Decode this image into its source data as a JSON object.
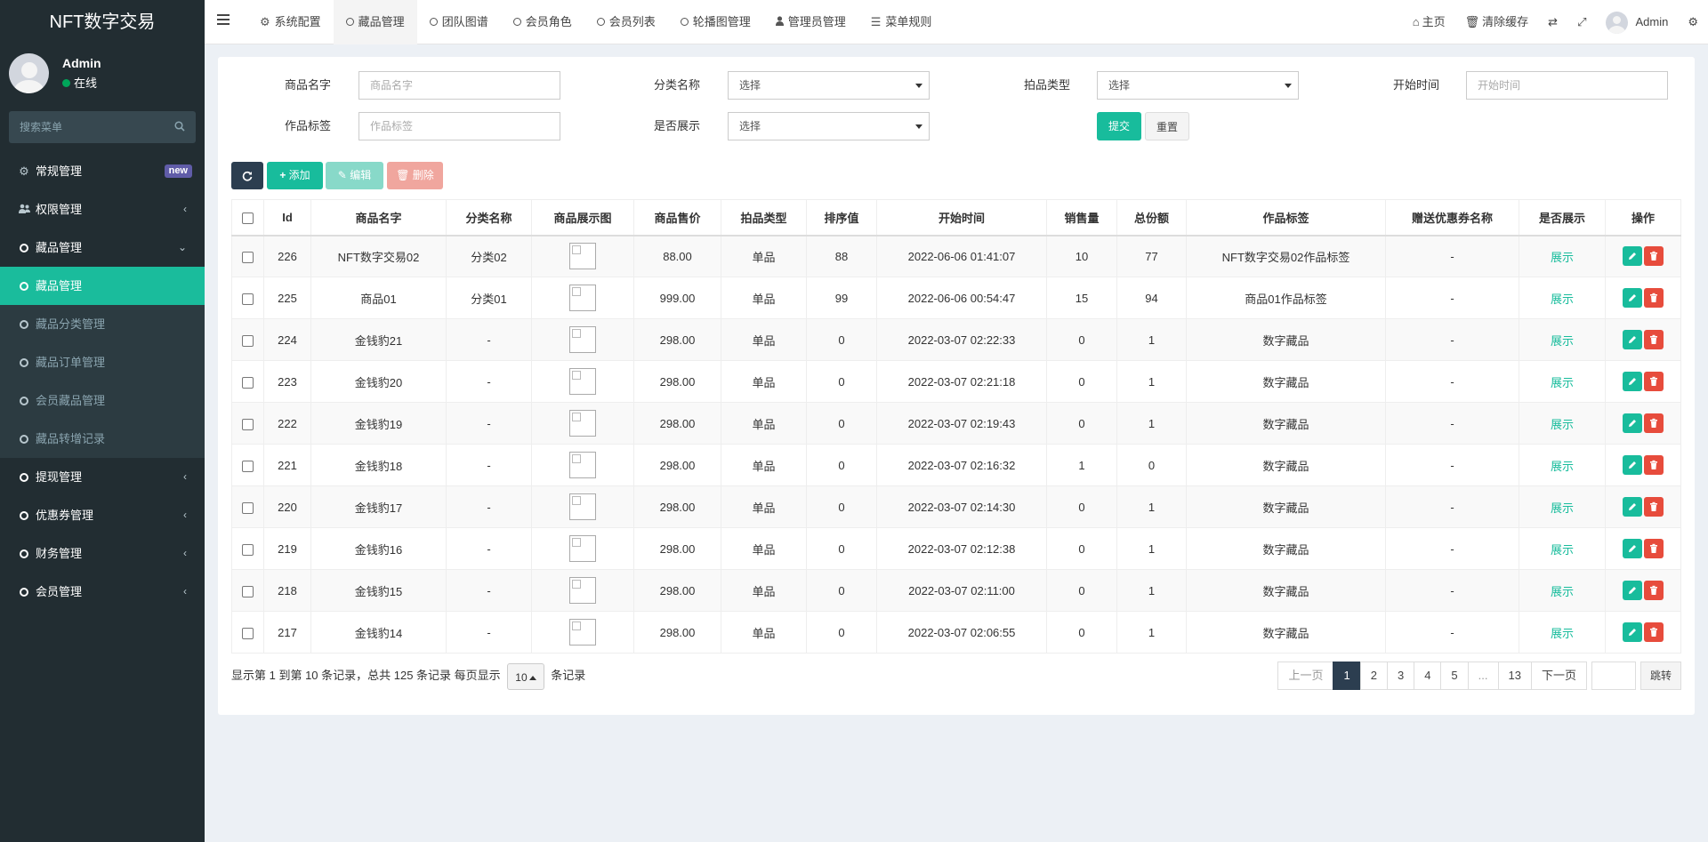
{
  "app": {
    "title": "NFT数字交易"
  },
  "user": {
    "name": "Admin",
    "status": "在线"
  },
  "sidebar": {
    "search_placeholder": "搜索菜单",
    "badge": "new",
    "items": [
      {
        "label": "常规管理"
      },
      {
        "label": "权限管理"
      },
      {
        "label": "藏品管理"
      },
      {
        "label": "提现管理"
      },
      {
        "label": "优惠券管理"
      },
      {
        "label": "财务管理"
      },
      {
        "label": "会员管理"
      }
    ],
    "sub_items": [
      {
        "label": "藏品管理"
      },
      {
        "label": "藏品分类管理"
      },
      {
        "label": "藏品订单管理"
      },
      {
        "label": "会员藏品管理"
      },
      {
        "label": "藏品转增记录"
      }
    ]
  },
  "header": {
    "tabs": [
      {
        "label": "系统配置"
      },
      {
        "label": "藏品管理"
      },
      {
        "label": "团队图谱"
      },
      {
        "label": "会员角色"
      },
      {
        "label": "会员列表"
      },
      {
        "label": "轮播图管理"
      },
      {
        "label": "管理员管理"
      },
      {
        "label": "菜单规则"
      }
    ],
    "home": "主页",
    "clear_cache": "清除缓存",
    "user": "Admin"
  },
  "search_form": {
    "name_label": "商品名字",
    "name_placeholder": "商品名字",
    "category_label": "分类名称",
    "category_value": "选择",
    "type_label": "拍品类型",
    "type_value": "选择",
    "start_label": "开始时间",
    "start_placeholder": "开始时间",
    "tag_label": "作品标签",
    "tag_placeholder": "作品标签",
    "show_label": "是否展示",
    "show_value": "选择",
    "submit": "提交",
    "reset": "重置"
  },
  "toolbar": {
    "add": "添加",
    "edit": "编辑",
    "delete": "删除"
  },
  "table": {
    "headers": [
      "Id",
      "商品名字",
      "分类名称",
      "商品展示图",
      "商品售价",
      "拍品类型",
      "排序值",
      "开始时间",
      "销售量",
      "总份额",
      "作品标签",
      "赠送优惠券名称",
      "是否展示",
      "操作"
    ],
    "rows": [
      {
        "id": "226",
        "name": "NFT数字交易02",
        "category": "分类02",
        "price": "88.00",
        "type": "单品",
        "sort": "88",
        "start": "2022-06-06 01:41:07",
        "sales": "10",
        "total": "77",
        "tag": "NFT数字交易02作品标签",
        "coupon": "-",
        "show": "展示"
      },
      {
        "id": "225",
        "name": "商品01",
        "category": "分类01",
        "price": "999.00",
        "type": "单品",
        "sort": "99",
        "start": "2022-06-06 00:54:47",
        "sales": "15",
        "total": "94",
        "tag": "商品01作品标签",
        "coupon": "-",
        "show": "展示"
      },
      {
        "id": "224",
        "name": "金钱豹21",
        "category": "-",
        "price": "298.00",
        "type": "单品",
        "sort": "0",
        "start": "2022-03-07 02:22:33",
        "sales": "0",
        "total": "1",
        "tag": "数字藏品",
        "coupon": "-",
        "show": "展示"
      },
      {
        "id": "223",
        "name": "金钱豹20",
        "category": "-",
        "price": "298.00",
        "type": "单品",
        "sort": "0",
        "start": "2022-03-07 02:21:18",
        "sales": "0",
        "total": "1",
        "tag": "数字藏品",
        "coupon": "-",
        "show": "展示"
      },
      {
        "id": "222",
        "name": "金钱豹19",
        "category": "-",
        "price": "298.00",
        "type": "单品",
        "sort": "0",
        "start": "2022-03-07 02:19:43",
        "sales": "0",
        "total": "1",
        "tag": "数字藏品",
        "coupon": "-",
        "show": "展示"
      },
      {
        "id": "221",
        "name": "金钱豹18",
        "category": "-",
        "price": "298.00",
        "type": "单品",
        "sort": "0",
        "start": "2022-03-07 02:16:32",
        "sales": "1",
        "total": "0",
        "tag": "数字藏品",
        "coupon": "-",
        "show": "展示"
      },
      {
        "id": "220",
        "name": "金钱豹17",
        "category": "-",
        "price": "298.00",
        "type": "单品",
        "sort": "0",
        "start": "2022-03-07 02:14:30",
        "sales": "0",
        "total": "1",
        "tag": "数字藏品",
        "coupon": "-",
        "show": "展示"
      },
      {
        "id": "219",
        "name": "金钱豹16",
        "category": "-",
        "price": "298.00",
        "type": "单品",
        "sort": "0",
        "start": "2022-03-07 02:12:38",
        "sales": "0",
        "total": "1",
        "tag": "数字藏品",
        "coupon": "-",
        "show": "展示"
      },
      {
        "id": "218",
        "name": "金钱豹15",
        "category": "-",
        "price": "298.00",
        "type": "单品",
        "sort": "0",
        "start": "2022-03-07 02:11:00",
        "sales": "0",
        "total": "1",
        "tag": "数字藏品",
        "coupon": "-",
        "show": "展示"
      },
      {
        "id": "217",
        "name": "金钱豹14",
        "category": "-",
        "price": "298.00",
        "type": "单品",
        "sort": "0",
        "start": "2022-03-07 02:06:55",
        "sales": "0",
        "total": "1",
        "tag": "数字藏品",
        "coupon": "-",
        "show": "展示"
      }
    ]
  },
  "footer": {
    "info_prefix": "显示第 1 到第 10 条记录，总共 125 条记录 每页显示",
    "page_size": "10",
    "info_suffix": "条记录",
    "prev": "上一页",
    "pages": [
      "1",
      "2",
      "3",
      "4",
      "5",
      "...",
      "13"
    ],
    "next": "下一页",
    "jump": "跳转"
  },
  "colors": {
    "sidebar_bg": "#222d32",
    "accent": "#18bc9c",
    "danger": "#e74c3c",
    "primary_dark": "#2c3e50"
  }
}
